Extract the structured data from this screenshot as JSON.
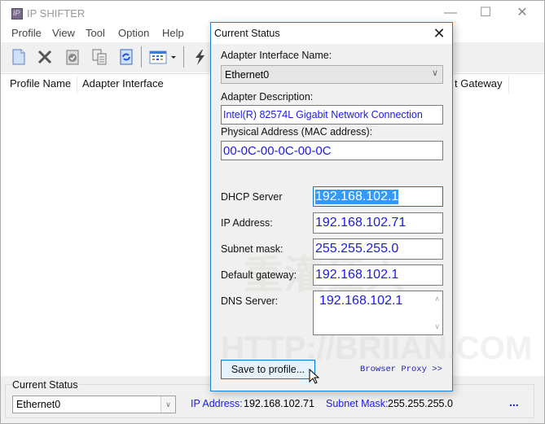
{
  "app": {
    "title": "IP SHIFTER",
    "icon_text": "IP",
    "window_controls": {
      "minimize": "—",
      "maximize": "☐",
      "close": "✕"
    }
  },
  "menu": [
    "Profile",
    "View",
    "Tool",
    "Option",
    "Help"
  ],
  "toolbar": {
    "buttons": [
      "new-profile-icon",
      "delete-icon",
      "apply-icon",
      "copy-icon",
      "refresh-icon",
      "view-grid-icon",
      "dropdown-arrow-icon",
      "quick-switch-icon"
    ]
  },
  "list": {
    "columns": [
      "Profile Name",
      "Adapter Interface",
      "Default Gateway"
    ],
    "visible_partial_column": "t Gateway",
    "rows": []
  },
  "status_panel": {
    "group_label": "Current Status",
    "adapter_selected": "Ethernet0",
    "ip_label": "IP Address:",
    "ip_value": "192.168.102.71",
    "mask_label": "Subnet Mask:",
    "mask_value": "255.255.255.0",
    "more": "..."
  },
  "dialog": {
    "title": "Current Status",
    "close": "✕",
    "adapter_name_label": "Adapter Interface Name:",
    "adapter_name_value": "Ethernet0",
    "adapter_desc_label": "Adapter Description:",
    "adapter_desc_value": "Intel(R) 82574L Gigabit Network Connection",
    "mac_label": "Physical Address (MAC address):",
    "mac_value": "00-0C-00-0C-00-0C",
    "fields": [
      {
        "label": "DHCP Server",
        "value": "192.168.102.1"
      },
      {
        "label": "IP  Address:",
        "value": "192.168.102.71"
      },
      {
        "label": "Subnet mask:",
        "value": "255.255.255.0"
      },
      {
        "label": "Default gateway:",
        "value": "192.168.102.1"
      },
      {
        "label": "DNS Server:",
        "value": "192.168.102.1"
      }
    ],
    "save_button": "Save to profile...",
    "proxy_link": "Browser Proxy >>",
    "watermark_line1": "重灌狂人",
    "watermark_line2": "HTTP://BRIIAN.COM"
  },
  "colors": {
    "value_blue": "#1a1ae6",
    "focus_border": "#0078d7",
    "selection": "#3399ff"
  }
}
